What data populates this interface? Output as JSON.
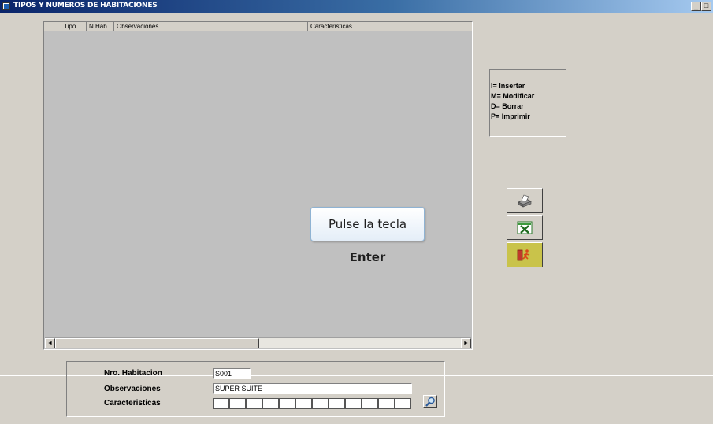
{
  "window": {
    "title": "TIPOS Y NUMEROS DE HABITACIONES",
    "min_glyph": "_",
    "max_glyph": "□"
  },
  "grid": {
    "columns": [
      "Tipo",
      "N.Hab",
      "Observaciones",
      "Caracteristicas"
    ],
    "rows": [],
    "scroll_left": "◄",
    "scroll_right": "►"
  },
  "tooltip": {
    "prefix": "Pulse la tecla ",
    "key": "Enter"
  },
  "legend": {
    "items": [
      "I= Insertar",
      "M= Modificar",
      "D= Borrar",
      "P= Imprimir"
    ]
  },
  "toolbar": {
    "icons": [
      "printer-icon",
      "excel-icon",
      "exit-icon"
    ]
  },
  "form": {
    "nro_label": "Nro. Habitacion",
    "nro_value": "S001",
    "obs_label": "Observaciones",
    "obs_value": "SUPER SUITE",
    "car_label": "Caracteristicas",
    "car_cells": 12
  },
  "colors": {
    "titlebar_start": "#0a246a",
    "titlebar_end": "#a6caf0",
    "window_bg": "#d4d0c8",
    "grid_bg": "#c0c0c0",
    "exit_button_bg": "#c9c34a"
  }
}
